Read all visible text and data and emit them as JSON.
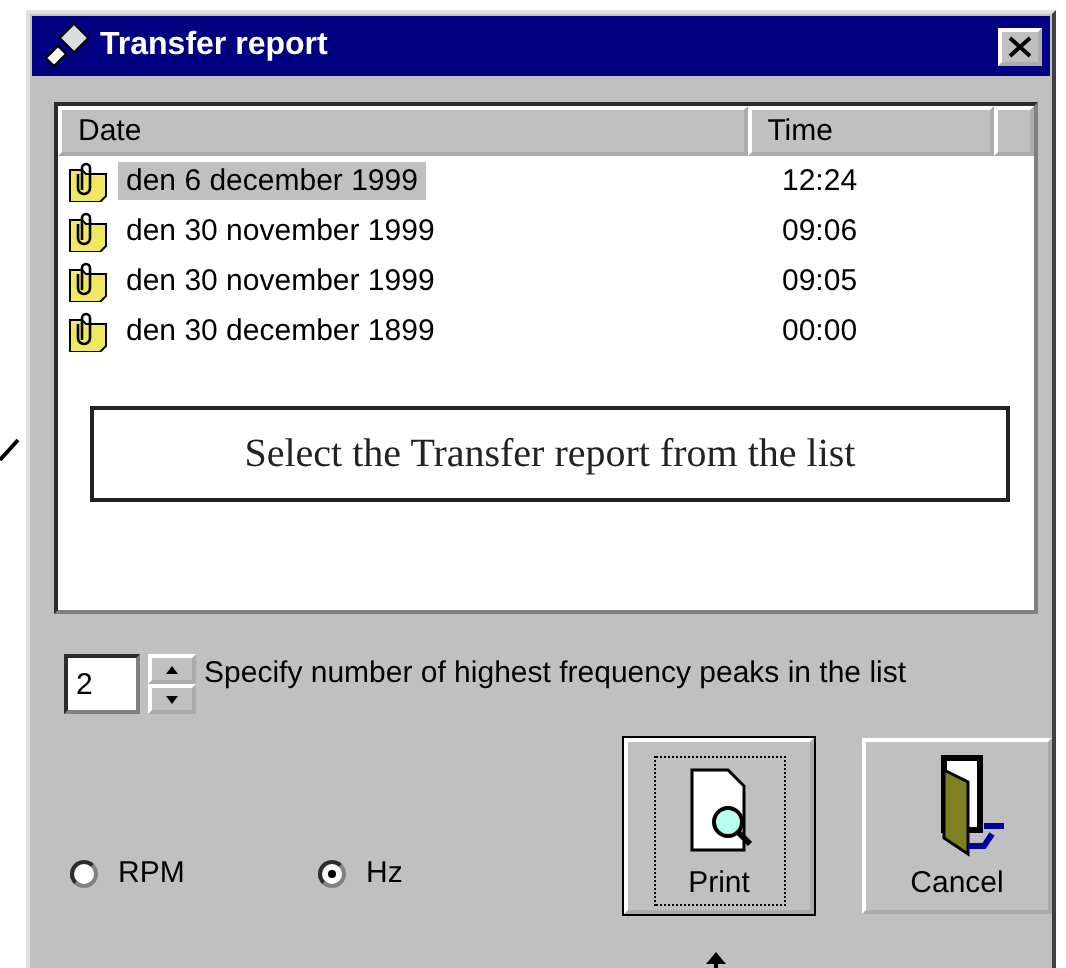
{
  "window": {
    "title": "Transfer report"
  },
  "list": {
    "columns": [
      "Date",
      "Time"
    ],
    "rows": [
      {
        "date": "den 6 december 1999",
        "time": "12:24",
        "selected": true
      },
      {
        "date": "den 30 november 1999",
        "time": "09:06",
        "selected": false
      },
      {
        "date": "den 30 november 1999",
        "time": "09:05",
        "selected": false
      },
      {
        "date": "den 30 december 1899",
        "time": "00:00",
        "selected": false
      }
    ]
  },
  "callout": {
    "text": "Select the Transfer report from the list"
  },
  "peaks": {
    "value": "2",
    "label": "Specify number of highest frequency peaks in the list"
  },
  "units": [
    {
      "label": "RPM",
      "selected": false
    },
    {
      "label": "Hz",
      "selected": true
    }
  ],
  "buttons": [
    {
      "label": "Print",
      "kind": "print",
      "focused": true
    },
    {
      "label": "Cancel",
      "kind": "cancel",
      "focused": false
    }
  ]
}
